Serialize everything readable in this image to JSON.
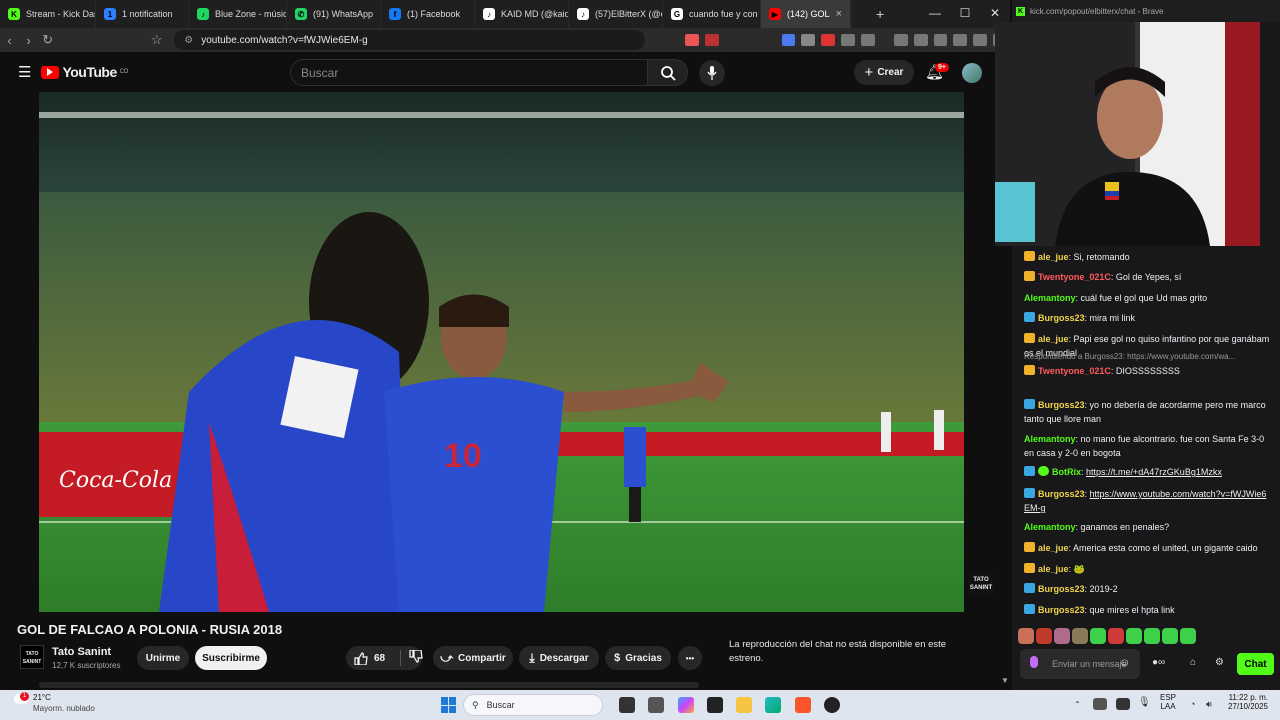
{
  "browser": {
    "tabs": [
      {
        "label": "Stream - Kick Das",
        "fav": "K",
        "color": "#53fc18"
      },
      {
        "label": "1 notification",
        "fav": "1",
        "color": "#2d7fff"
      },
      {
        "label": "Blue Zone - músic",
        "fav": "♪",
        "color": "#1ed760"
      },
      {
        "label": "(91) WhatsApp",
        "fav": "✆",
        "color": "#25d366"
      },
      {
        "label": "(1) Facebook",
        "fav": "f",
        "color": "#1877f2"
      },
      {
        "label": "KAID MD (@kaid",
        "fav": "♪",
        "color": "#ffffff"
      },
      {
        "label": "(57)ElBitterX (@e",
        "fav": "♪",
        "color": "#ffffff"
      },
      {
        "label": "cuando fue y con",
        "fav": "G",
        "color": "#ffffff"
      },
      {
        "label": "(142) GOL",
        "fav": "▶",
        "color": "#ff0000",
        "active": true
      }
    ],
    "new_tab": "+",
    "url": "youtube.com/watch?v=fWJWie6EM-g",
    "win_min": "—",
    "win_max": "☐",
    "win_close": "✕"
  },
  "youtube": {
    "logo": "YouTube",
    "logo_country": "CO",
    "search_placeholder": "Buscar",
    "create": "Crear",
    "notif_count": "9+",
    "video_title": "GOL DE FALCAO A POLONIA - RUSIA 2018",
    "channel": "Tato Sanint",
    "channel_logo": "TATO SANINT",
    "subs": "12,7 K suscriptores",
    "join": "Unirme",
    "subscribe": "Suscribirme",
    "likes": "68",
    "share": "Compartir",
    "download": "Descargar",
    "thanks": "Gracias",
    "more": "•••",
    "chat_replay": "La reproducción del chat no está disponible en este estreno.",
    "jersey_number": "10",
    "ad_board": "Coca-Cola"
  },
  "kick": {
    "url": "kick.com/popout/elbitterx/chat - Brave",
    "messages": [
      {
        "user": "ale_jue",
        "text": "Si, retomando",
        "color": "#f1d34b",
        "badge": "crown"
      },
      {
        "user": "Twentyone_021C",
        "text": "Gol de Yepes, sí",
        "color": "#ff5b5b",
        "badge": "crown"
      },
      {
        "user": "Alemantony",
        "text": "cuál fue el gol que Ud mas grito",
        "color": "#53fc18",
        "badge": ""
      },
      {
        "user": "Burgoss23",
        "text": "mira mi link",
        "color": "#f1d34b",
        "badge": "sub"
      },
      {
        "user": "ale_jue",
        "text": "Papi ese gol no quiso infantino por que ganábamos el mundial",
        "color": "#f1d34b",
        "badge": "crown"
      },
      {
        "reply": "Respondiendo a Burgoss23: https://www.youtube.com/wa...",
        "user": "Twentyone_021C",
        "text": "DIOSSSSSSSS",
        "color": "#ff5b5b",
        "badge": "crown"
      },
      {
        "user": "Burgoss23",
        "text": "yo no debería de acordarme pero me marco tanto que llore man",
        "color": "#f1d34b",
        "badge": "sub"
      },
      {
        "user": "Alemantony",
        "text": "no mano fue alcontrario. fue con Santa Fe 3-0 en casa y 2-0 en bogota",
        "color": "#53fc18",
        "badge": ""
      },
      {
        "user": "BotRix",
        "text": "https://t.me/+dA47rzGKuBg1Mzkx",
        "color": "#53fc18",
        "badge": "bot",
        "link": true
      },
      {
        "user": "Burgoss23",
        "text": "https://www.youtube.com/watch?v=fWJWie6EM-g",
        "color": "#f1d34b",
        "badge": "sub",
        "link": true
      },
      {
        "user": "Alemantony",
        "text": "ganamos en penales?",
        "color": "#53fc18",
        "badge": ""
      },
      {
        "user": "ale_jue",
        "text": "America esta como el united, un gigante caido",
        "color": "#f1d34b",
        "badge": "crown"
      },
      {
        "user": "ale_jue",
        "text": "🐸",
        "color": "#f1d34b",
        "badge": "crown"
      },
      {
        "user": "Burgoss23",
        "text": "2019-2",
        "color": "#f1d34b",
        "badge": "sub"
      },
      {
        "user": "Burgoss23",
        "text": "que mires el hpta link",
        "color": "#f1d34b",
        "badge": "sub"
      }
    ],
    "input_placeholder": "Enviar un mensaje",
    "send": "Chat"
  },
  "taskbar": {
    "weather_temp": "21°C",
    "weather_desc": "Mayorm. nublado",
    "weather_badge": "1",
    "search": "Buscar",
    "lang": "ESP",
    "lang_sub": "LAA",
    "time": "11:22 p. m.",
    "date": "27/10/2025"
  }
}
